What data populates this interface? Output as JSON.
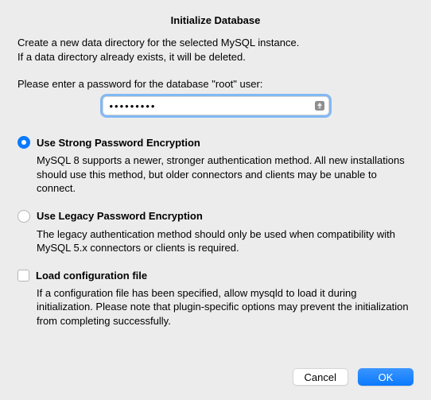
{
  "title": "Initialize Database",
  "intro_line1": "Create a new data directory for the selected MySQL instance.",
  "intro_line2": "If a data directory already exists, it will be deleted.",
  "password_prompt": "Please enter a password for the database \"root\" user:",
  "password_value": "•••••••••",
  "options": {
    "strong": {
      "label": "Use Strong Password Encryption",
      "desc": "MySQL 8 supports a newer, stronger authentication method. All new installations should use this method, but older connectors and clients may be unable to connect.",
      "selected": true
    },
    "legacy": {
      "label": "Use Legacy Password Encryption",
      "desc": "The legacy authentication method should only be used when compatibility with MySQL 5.x connectors or clients is required.",
      "selected": false
    },
    "config": {
      "label": "Load configuration file",
      "desc": "If a configuration file has been specified, allow mysqld to load it during initialization. Please note that plugin-specific options may prevent the initialization from completing successfully.",
      "checked": false
    }
  },
  "buttons": {
    "cancel": "Cancel",
    "ok": "OK"
  }
}
